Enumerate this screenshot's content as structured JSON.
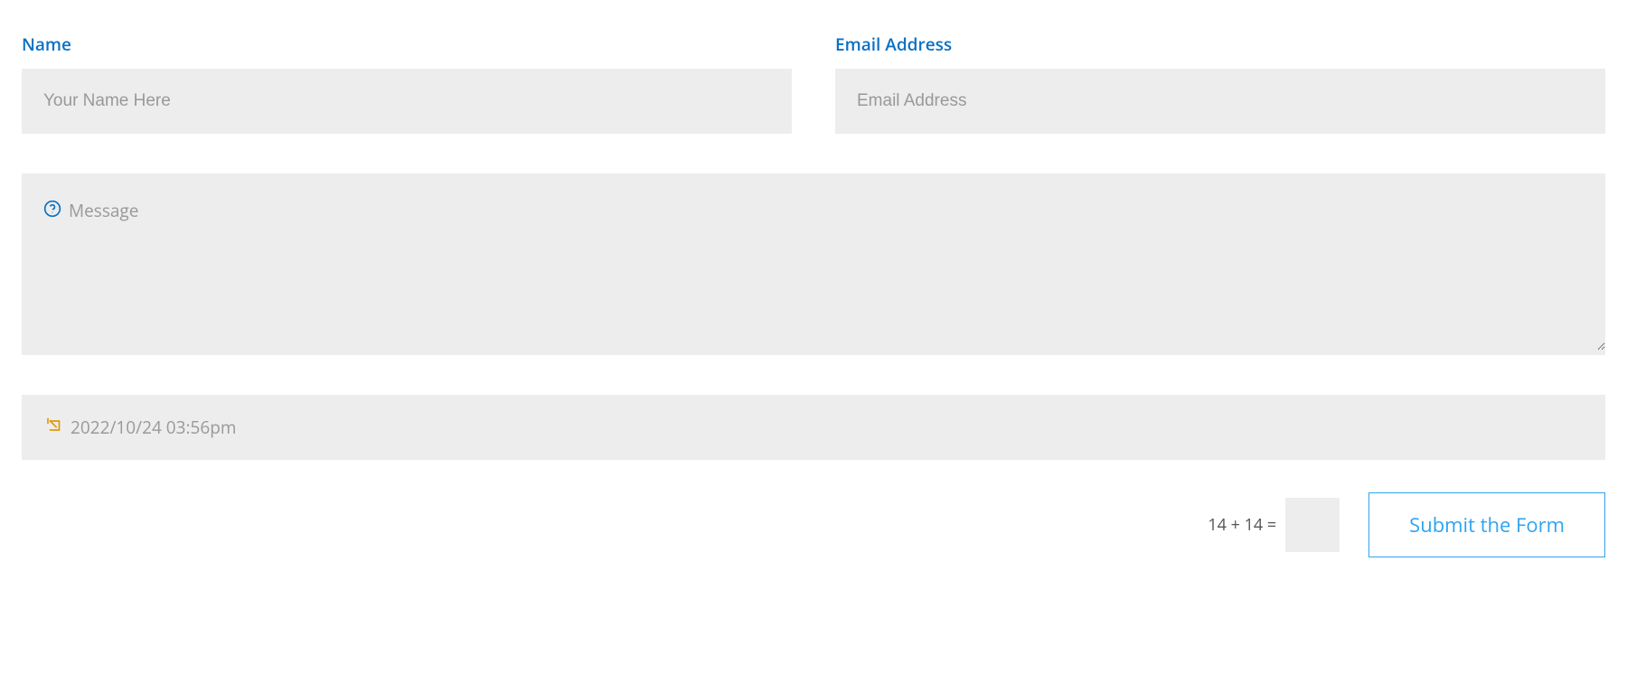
{
  "name": {
    "label": "Name",
    "placeholder": "Your Name Here"
  },
  "email": {
    "label": "Email Address",
    "placeholder": "Email Address"
  },
  "message": {
    "placeholder": "Message"
  },
  "datetime": {
    "value": "2022/10/24 03:56pm"
  },
  "captcha": {
    "question": "14 + 14 ="
  },
  "submit": {
    "label": "Submit the Form"
  }
}
